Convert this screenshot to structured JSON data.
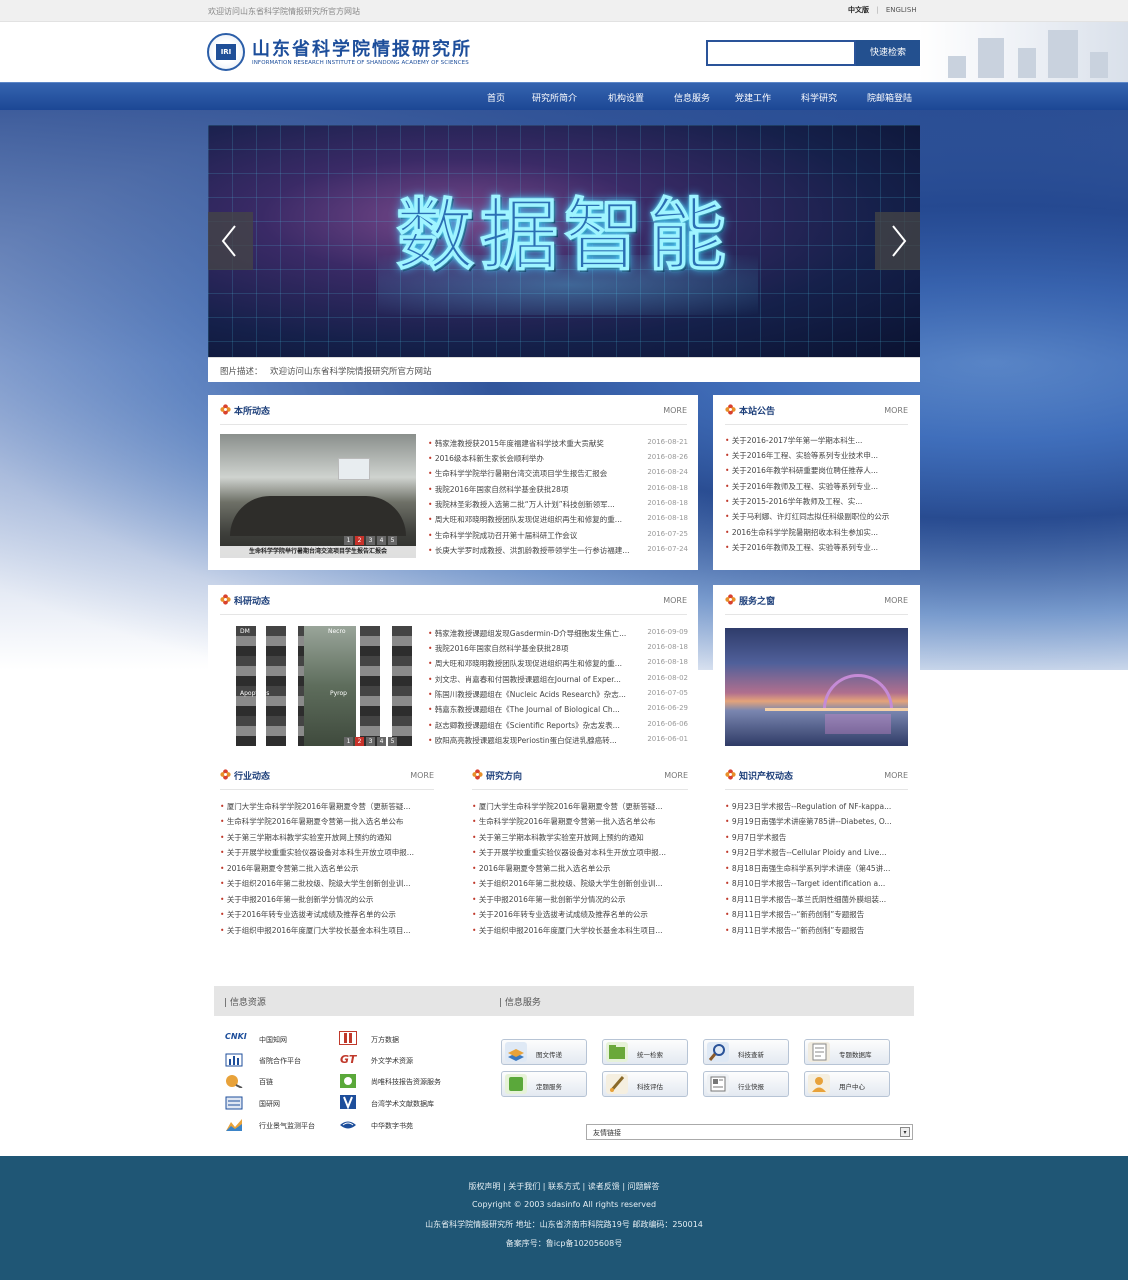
{
  "topbar": {
    "welcome": "欢迎访问山东省科学院情报研究所官方网站",
    "lang_cn": "中文版",
    "lang_sep": "|",
    "lang_en": "ENGLISH"
  },
  "header": {
    "logo_badge": "IRI",
    "logo_cn": "山东省科学院情报研究所",
    "logo_en": "INFORMATION RESEARCH INSTITUTE OF SHANDONG ACADEMY OF SCIENCES",
    "search_value": "",
    "search_button": "快速检索"
  },
  "nav": [
    "首页",
    "研究所简介",
    "机构设置",
    "信息服务",
    "党建工作",
    "科学研究",
    "院邮箱登陆"
  ],
  "banner": {
    "title": "数据智能",
    "caption_label": "图片描述：",
    "caption_text": "欢迎访问山东省科学院情报研究所官方网站"
  },
  "panels": {
    "news": {
      "title": "本所动态",
      "more": "MORE",
      "photo_caption": "生命科学学院举行暑期台湾交流项目学生报告汇报会",
      "dots": [
        "1",
        "2",
        "3",
        "4",
        "5"
      ],
      "items": [
        {
          "text": "韩家淮教授获2015年度福建省科学技术重大贡献奖",
          "date": "2016-08-21"
        },
        {
          "text": "2016级本科新生家长会顺利举办",
          "date": "2016-08-26"
        },
        {
          "text": "生命科学学院举行暑期台湾交流项目学生报告汇报会",
          "date": "2016-08-24"
        },
        {
          "text": "我院2016年国家自然科学基金获批28项",
          "date": "2016-08-18"
        },
        {
          "text": "我院林圣彩教授入选第二批“万人计划”科技创新领军...",
          "date": "2016-08-18"
        },
        {
          "text": "周大旺和邓晓明教授团队发现促进组织再生和修复的重...",
          "date": "2016-08-18"
        },
        {
          "text": "生命科学学院成功召开第十届科研工作会议",
          "date": "2016-07-25"
        },
        {
          "text": "长庚大学罗时成教授、洪凯龄教授带领学生一行参访福建...",
          "date": "2016-07-24"
        }
      ]
    },
    "notice": {
      "title": "本站公告",
      "more": "MORE",
      "items": [
        "关于2016-2017学年第一学期本科生...",
        "关于2016年工程、实验等系列专业技术申...",
        "关于2016年教学科研重要岗位聘任推荐人...",
        "关于2016年教师及工程、实验等系列专业...",
        "关于2015-2016学年教师及工程、实...",
        "关于马利娜、许灯红同志拟任科级副职位的公示",
        "2016生命科学学院暑期招收本科生参加实...",
        "关于2016年教师及工程、实验等系列专业..."
      ]
    },
    "research": {
      "title": "科研动态",
      "more": "MORE",
      "dots": [
        "1",
        "2",
        "3",
        "4",
        "5"
      ],
      "photo_labels": [
        "DM",
        "Necro",
        "Apoptosis",
        "Pyrop"
      ],
      "items": [
        {
          "text": "韩家淮教授课题组发现Gasdermin-D介导细胞发生焦亡...",
          "date": "2016-09-09"
        },
        {
          "text": "我院2016年国家自然科学基金获批28项",
          "date": "2016-08-18"
        },
        {
          "text": "周大旺和邓晓明教授团队发现促进组织再生和修复的重...",
          "date": "2016-08-18"
        },
        {
          "text": "刘文忠、肖嘉春和付国教授课题组在Journal of Exper...",
          "date": "2016-08-02"
        },
        {
          "text": "陈国川教授课题组在《Nucleic Acids Research》杂志...",
          "date": "2016-07-05"
        },
        {
          "text": "韩嘉东教授课题组在《The Journal of Biological Ch...",
          "date": "2016-06-29"
        },
        {
          "text": "赵志卿教授课题组在《Scientific Reports》杂志发表...",
          "date": "2016-06-06"
        },
        {
          "text": "欧阳高亮教授课题组发现Periostin蛋白促进乳腺癌转...",
          "date": "2016-06-01"
        }
      ]
    },
    "service": {
      "title": "服务之窗",
      "more": "MORE"
    },
    "industry": {
      "title": "行业动态",
      "more": "MORE",
      "items": [
        "厦门大学生命科学学院2016年暑期夏令营（更新答疑...",
        "生命科学学院2016年暑期夏令营第一批入选名单公布",
        "关于第三学期本科教学实验室开放网上预约的通知",
        "关于开展学校重重实验仪器设备对本科生开放立项申报...",
        "2016年暑期夏令营第二批入选名单公示",
        "关于组织2016年第二批校级、院级大学生创新创业训...",
        "关于申报2016年第一批创新学分情况的公示",
        "关于2016年转专业选拔考试成绩及推荐名单的公示",
        "关于组织申报2016年度厦门大学校长基金本科生项目..."
      ]
    },
    "direction": {
      "title": "研究方向",
      "more": "MORE",
      "items": [
        "厦门大学生命科学学院2016年暑期夏令营（更新答疑...",
        "生命科学学院2016年暑期夏令营第一批入选名单公布",
        "关于第三学期本科教学实验室开放网上预约的通知",
        "关于开展学校重重实验仪器设备对本科生开放立项申报...",
        "2016年暑期夏令营第二批入选名单公示",
        "关于组织2016年第二批校级、院级大学生创新创业训...",
        "关于申报2016年第一批创新学分情况的公示",
        "关于2016年转专业选拔考试成绩及推荐名单的公示",
        "关于组织申报2016年度厦门大学校长基金本科生项目..."
      ]
    },
    "ip": {
      "title": "知识产权动态",
      "more": "MORE",
      "items": [
        "9月23日学术报告--Regulation of NF-kappa...",
        "9月19日南强学术讲座第785讲--Diabetes, O...",
        "9月7日学术报告",
        "9月2日学术报告--Cellular Ploidy and Live...",
        "8月18日南强生命科学系列学术讲座（第45讲...",
        "8月10日学术报告--Target identification a...",
        "8月11日学术报告--革兰氏阴性细菌外膜组装...",
        "8月11日学术报告--“新药创制”专题报告",
        "8月11日学术报告--“新药创制”专题报告"
      ]
    }
  },
  "resources": {
    "title": "信息资源",
    "items": [
      "中国知网",
      "万方数据",
      "省院合作平台",
      "外文学术资源",
      "百链",
      "尚唯科技报告资源服务",
      "国研网",
      "台湾学术文献数据库",
      "行业景气监测平台",
      "中华数字书苑"
    ],
    "cnki_mark": "CNKI"
  },
  "services": {
    "title": "信息服务",
    "items": [
      "图文传递",
      "统一检索",
      "科技查新",
      "专题数据库",
      "定题服务",
      "科技评估",
      "行业快报",
      "用户中心"
    ]
  },
  "friend_links": {
    "label": "友情链接",
    "arrow": "▾"
  },
  "footer": {
    "links": "版权声明 | 关于我们 | 联系方式 | 读者反馈 | 问题解答",
    "copyright": "Copyright © 2003 sdasinfo All rights reserved",
    "address": "山东省科学院情报研究所 地址：山东省济南市科院路19号 邮政编码：250014",
    "icp": "备案序号：鲁icp备10205608号"
  },
  "colors": {
    "nav_blue": "#1c4795",
    "title_navy": "#1d3f7a",
    "bullet_red": "#c0392b",
    "footer_teal": "#1f5675"
  }
}
